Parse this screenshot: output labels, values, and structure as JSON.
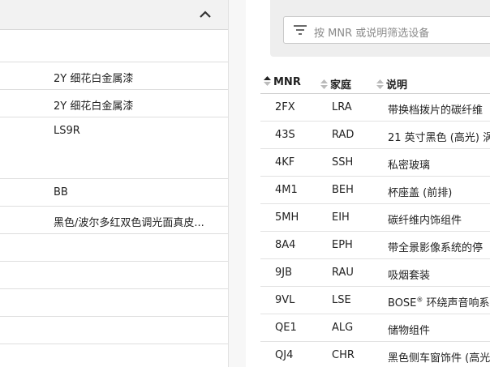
{
  "left": {
    "rows": [
      {
        "value": ""
      },
      {
        "value": "2Y 细花白金属漆"
      },
      {
        "value": "2Y 细花白金属漆"
      },
      {
        "value": "LS9R"
      },
      {
        "value": "BB"
      },
      {
        "value": "黑色/波尔多红双色调光面真皮..."
      },
      {
        "value": ""
      },
      {
        "value": ""
      },
      {
        "value": ""
      },
      {
        "value": ""
      }
    ]
  },
  "filter": {
    "placeholder": "按 MNR 或说明筛选设备"
  },
  "table": {
    "headers": {
      "mnr": "MNR",
      "family": "家庭",
      "description": "说明"
    },
    "rows": [
      {
        "mnr": "2FX",
        "family": "LRA",
        "description": "带换档拨片的碳纤维"
      },
      {
        "mnr": "43S",
        "family": "RAD",
        "description": "21 英寸黑色 (高光) 涡"
      },
      {
        "mnr": "4KF",
        "family": "SSH",
        "description": "私密玻璃"
      },
      {
        "mnr": "4M1",
        "family": "BEH",
        "description": "杯座盖 (前排)"
      },
      {
        "mnr": "5MH",
        "family": "EIH",
        "description": "碳纤维内饰组件"
      },
      {
        "mnr": "8A4",
        "family": "EPH",
        "description": "带全景影像系统的停"
      },
      {
        "mnr": "9JB",
        "family": "RAU",
        "description": "吸烟套装"
      },
      {
        "mnr": "9VL",
        "family": "LSE",
        "description": "BOSE",
        "sup": "®",
        "description_rest": " 环绕声音响系"
      },
      {
        "mnr": "QE1",
        "family": "ALG",
        "description": "储物组件"
      },
      {
        "mnr": "QJ4",
        "family": "CHR",
        "description": "黑色侧车窗饰件 (高光"
      }
    ]
  },
  "colors": {
    "header_bg": "#f2f2f2",
    "filter_bg": "#eeeeee",
    "border": "#dedede"
  },
  "icons": {
    "collapse": "chevron-up-icon",
    "filter": "filter-icon",
    "sort": "sort-icon"
  }
}
